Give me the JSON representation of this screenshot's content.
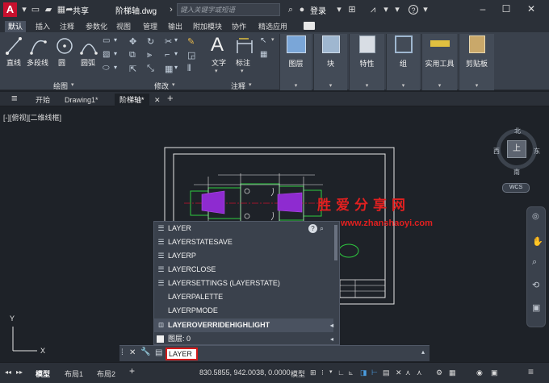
{
  "titlebar": {
    "logo": "A",
    "share": "共享",
    "filename": "阶梯轴.dwg",
    "search_placeholder": "键入关键字或短语",
    "login": "登录",
    "help": "?"
  },
  "ribbon_tabs": [
    "默认",
    "插入",
    "注释",
    "参数化",
    "视图",
    "管理",
    "输出",
    "附加模块",
    "协作",
    "精选应用"
  ],
  "ribbon": {
    "draw_tools": [
      "直线",
      "多段线",
      "圆",
      "圆弧"
    ],
    "panel_draw": "绘图",
    "panel_modify": "修改",
    "panel_annotation": "注释",
    "text_label": "文字",
    "dim_label": "标注",
    "layers_label": "图层",
    "block_label": "块",
    "props_label": "特性",
    "group_label": "组",
    "utilities_label": "实用工具",
    "clipboard_label": "剪贴板"
  },
  "file_tabs": {
    "start": "开始",
    "drawing1": "Drawing1*",
    "current": "阶梯轴*"
  },
  "viewport": {
    "label": "[-][俯视][二维线框]"
  },
  "viewcube": {
    "north": "北",
    "south": "南",
    "west": "西",
    "east": "东",
    "top": "上",
    "wcs": "WCS"
  },
  "watermark": {
    "line1": "胜爱分享网",
    "line2": "www.zhanshaoyi.com"
  },
  "autocomplete": [
    "LAYER",
    "LAYERSTATESAVE",
    "LAYERP",
    "LAYERCLOSE",
    "LAYERSETTINGS (LAYERSTATE)",
    "LAYERPALETTE",
    "LAYERPMODE",
    "LAYEROVERRIDEHIGHLIGHT",
    "图层: 0"
  ],
  "command": {
    "value": "LAYER"
  },
  "axes": {
    "x": "X",
    "y": "Y"
  },
  "statusbar": {
    "model_tab": "模型",
    "layout1": "布局1",
    "layout2": "布局2",
    "coords": "830.5855, 942.0038, 0.0000",
    "model_btn": "模型"
  }
}
